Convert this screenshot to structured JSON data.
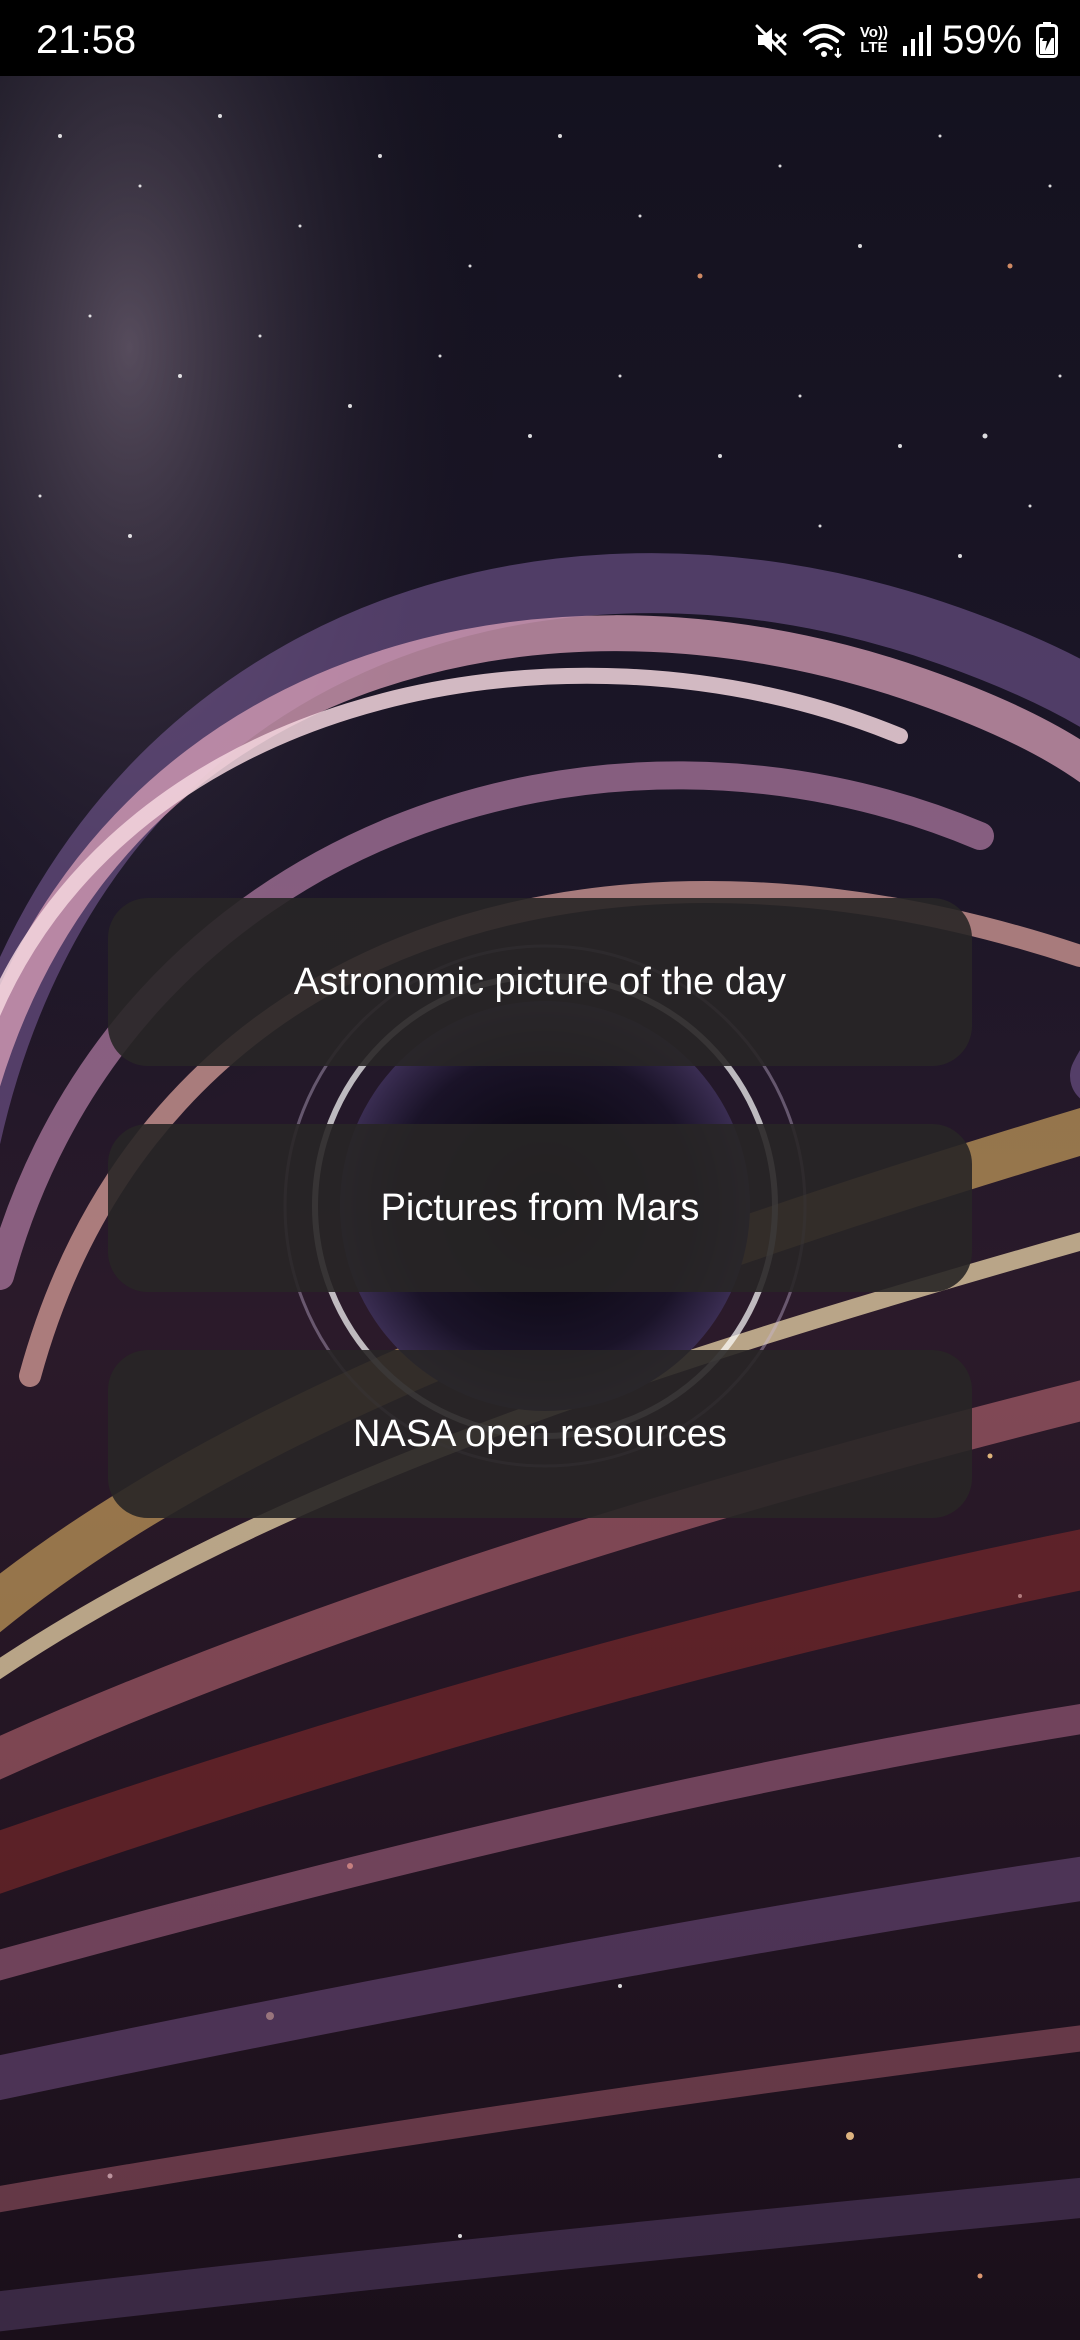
{
  "status_bar": {
    "time": "21:58",
    "icons": [
      "mute-icon",
      "wifi-icon",
      "volte-icon",
      "signal-icon",
      "battery-charging-icon"
    ],
    "volte_top": "Vo))",
    "volte_bottom": "LTE",
    "battery_percent": "59%"
  },
  "wallpaper": {
    "description_icon": "black-hole-galaxy-wallpaper",
    "colors": {
      "space": "#0d0a14",
      "swirl_pink": "#d9a0b8",
      "swirl_purple": "#7d5f9c",
      "swirl_gold": "#f2c36a",
      "swirl_red": "#8a2c2c",
      "event_horizon": "#120c1c"
    }
  },
  "menu": {
    "items": [
      {
        "label": "Astronomic picture of the day"
      },
      {
        "label": "Pictures from Mars"
      },
      {
        "label": "NASA open resources"
      }
    ],
    "button_color": "#282626"
  }
}
